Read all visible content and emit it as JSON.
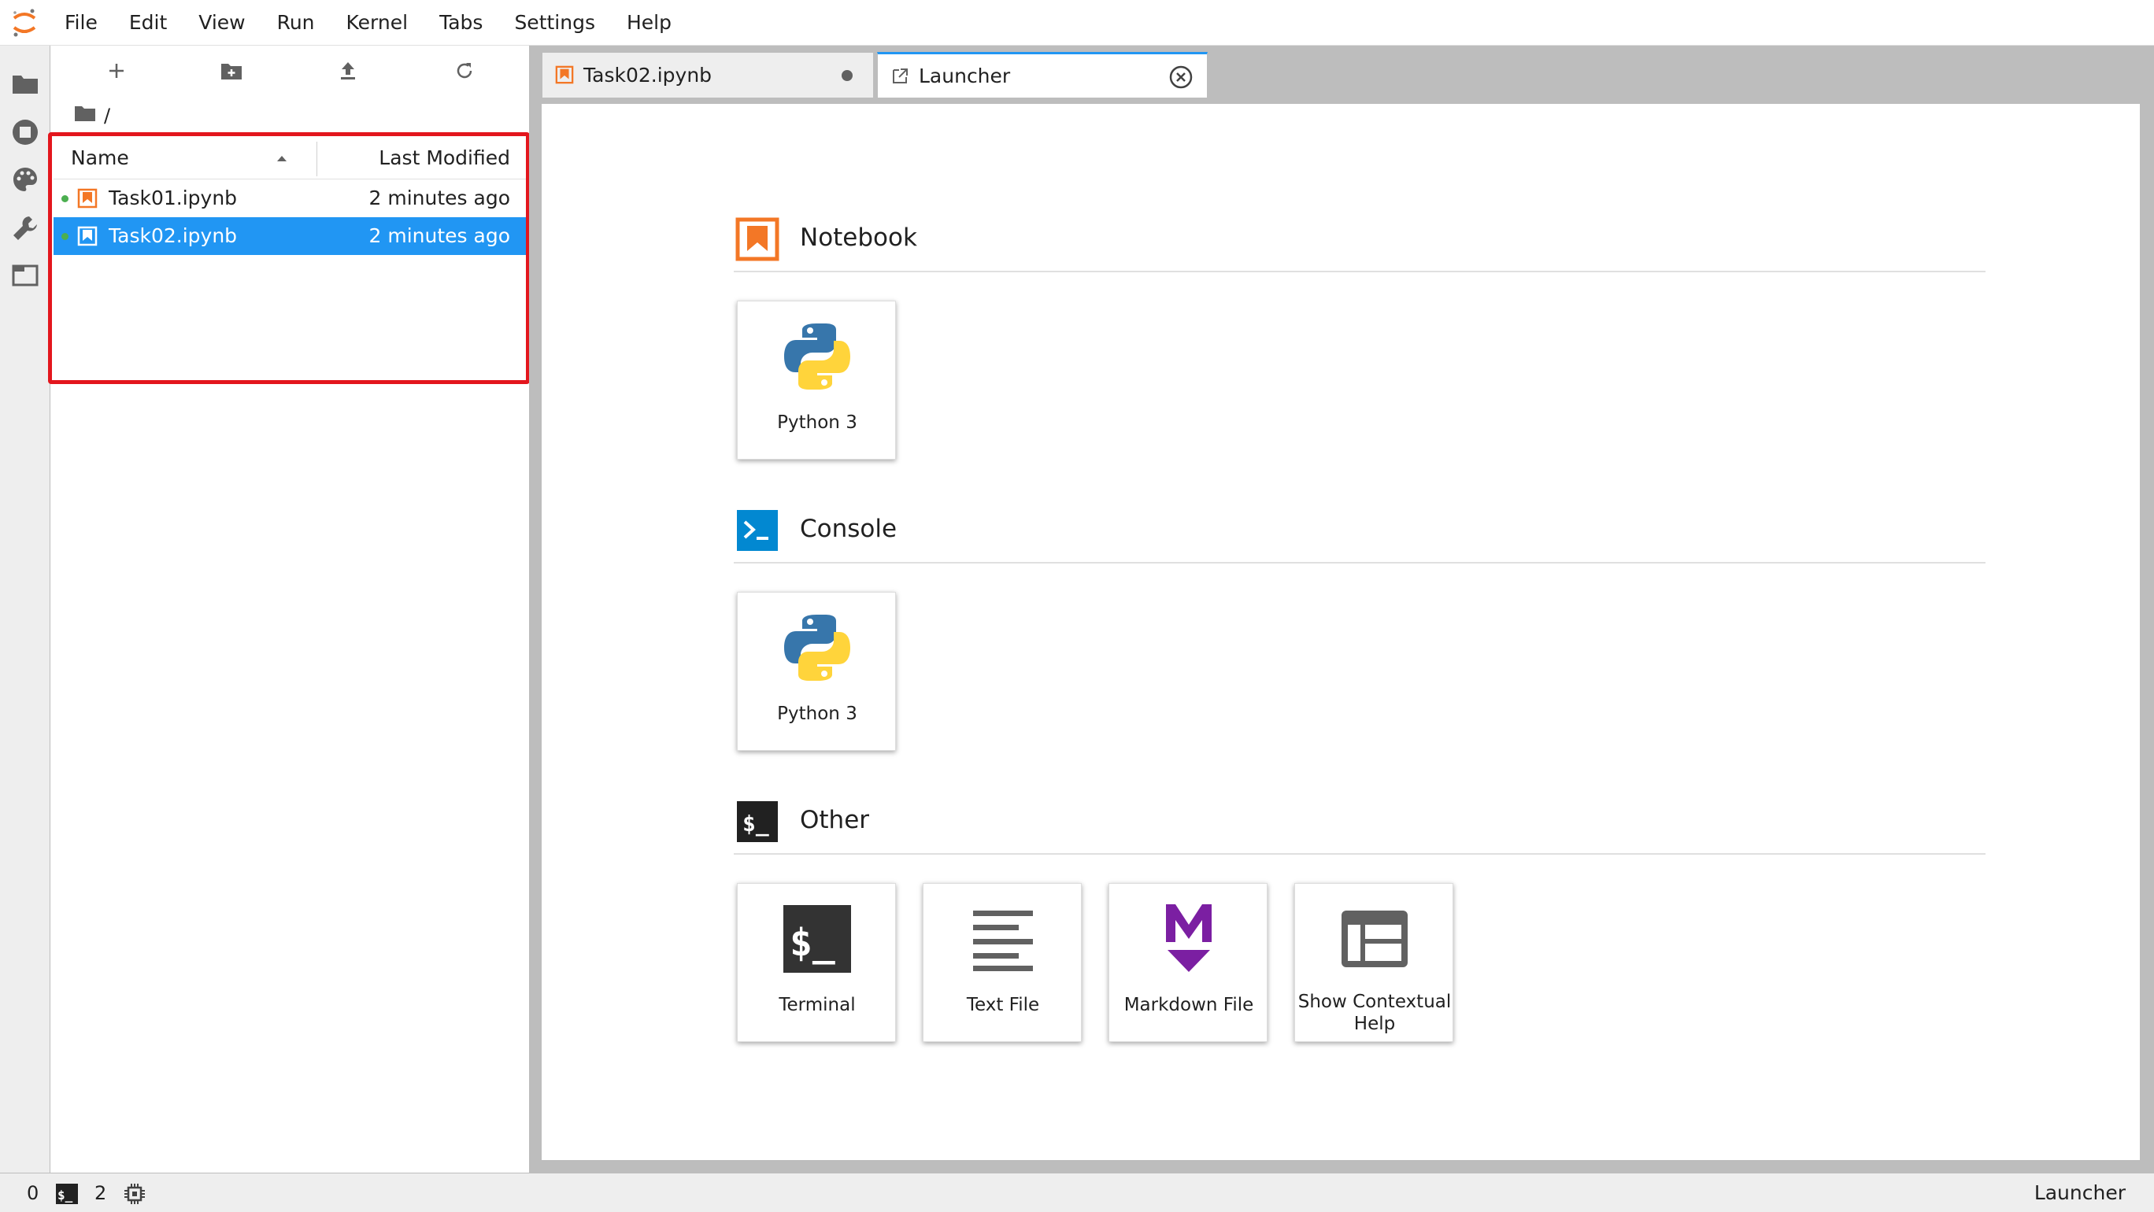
{
  "menubar": {
    "items": [
      "File",
      "Edit",
      "View",
      "Run",
      "Kernel",
      "Tabs",
      "Settings",
      "Help"
    ]
  },
  "activitybar": {
    "icons": [
      "folder-icon",
      "running-icon",
      "palette-icon",
      "wrench-icon",
      "tabs-icon"
    ]
  },
  "filebrowser": {
    "breadcrumb": "/",
    "header": {
      "name": "Name",
      "last_modified": "Last Modified"
    },
    "files": [
      {
        "name": "Task01.ipynb",
        "modified": "2 minutes ago",
        "selected": false,
        "running": true
      },
      {
        "name": "Task02.ipynb",
        "modified": "2 minutes ago",
        "selected": true,
        "running": true
      }
    ]
  },
  "tabs": [
    {
      "label": "Task02.ipynb",
      "active": false,
      "dirty": true
    },
    {
      "label": "Launcher",
      "active": true
    }
  ],
  "launcher": {
    "sections": [
      {
        "title": "Notebook",
        "cards": [
          "Python 3"
        ]
      },
      {
        "title": "Console",
        "cards": [
          "Python 3"
        ]
      },
      {
        "title": "Other",
        "cards": [
          "Terminal",
          "Text File",
          "Markdown File",
          "Show Contextual Help"
        ]
      }
    ]
  },
  "statusbar": {
    "kernels_count": "0",
    "terminals_count": "2",
    "right_label": "Launcher"
  },
  "colors": {
    "selection": "#2196f3",
    "annotation": "#e3161d",
    "notebook_orange": "#f37726",
    "console_blue": "#0288d1",
    "markdown_purple": "#7b1fa2"
  }
}
